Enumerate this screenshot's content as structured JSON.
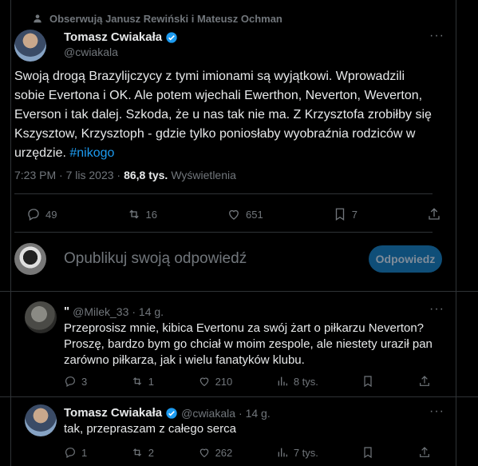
{
  "social_context": "Obserwują Janusz Rewiński i Mateusz Ochman",
  "main_tweet": {
    "author_name": "Tomasz Cwiakała",
    "handle": "@cwiakala",
    "text": "Swoją drogą Brazylijczycy z tymi imionami są wyjątkowi. Wprowadzili sobie Evertona i OK. Ale potem wjechali Ewerthon, Neverton, Weverton, Everson i tak dalej. Szkoda, że u nas tak nie ma. Z Krzysztofa zrobiłby się Kszysztow, Krzysztoph - gdzie tylko poniosłaby wyobraźnia rodziców w urzędzie.",
    "hashtag": "#nikogo",
    "time": "7:23 PM · 7 lis 2023 ·",
    "views": "86,8 tys.",
    "views_label": "Wyświetlenia",
    "replies": "49",
    "reposts": "16",
    "likes": "651",
    "bookmarks": "7"
  },
  "reply_box": {
    "placeholder": "Opublikuj swoją odpowiedź",
    "button": "Odpowiedz"
  },
  "replies": [
    {
      "name": "\"",
      "handle": "@Milek_33",
      "time": "· 14 g.",
      "text": "Przeprosisz mnie, kibica Evertonu za swój żart o piłkarzu Neverton? Proszę, bardzo bym go chciał w moim zespole, ale niestety uraził pan zarówno piłkarza, jak i wielu fanatyków klubu.",
      "replies": "3",
      "reposts": "1",
      "likes": "210",
      "views": "8 tys."
    },
    {
      "name": "Tomasz Cwiakała",
      "handle": "@cwiakala",
      "time": "· 14 g.",
      "text": "tak, przepraszam z całego serca",
      "replies": "1",
      "reposts": "2",
      "likes": "262",
      "views": "7 tys."
    }
  ],
  "colors": {
    "accent": "#1d9bf0",
    "muted": "#71767b",
    "text": "#e7e9ea",
    "background": "#000000"
  }
}
